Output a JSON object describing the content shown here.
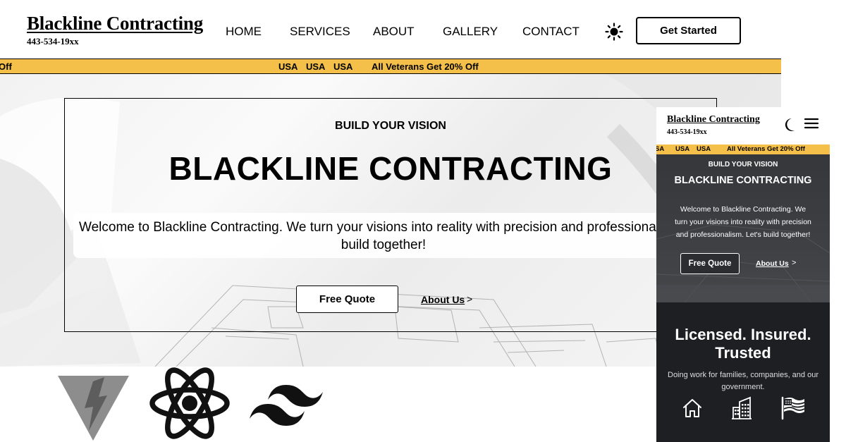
{
  "brand": {
    "name": "Blackline Contracting",
    "phone": "443-534-19xx"
  },
  "nav": [
    "HOME",
    "SERVICES",
    "ABOUT",
    "GALLERY",
    "CONTACT"
  ],
  "header": {
    "theme_icon": "sun-icon",
    "cta_label": "Get Started"
  },
  "ticker": {
    "left_fragment": "Off",
    "items": [
      "USA",
      "USA",
      "USA"
    ],
    "promo": "All Veterans Get 20% Off"
  },
  "hero": {
    "kicker": "BUILD YOUR VISION",
    "title": "BLACKLINE CONTRACTING",
    "desc_line1": "Welcome to Blackline Contracting. We turn your visions into reality with precision and professionalis",
    "desc_line2": "build together!",
    "quote_label": "Free Quote",
    "about_label": "About Us",
    "about_chevron": ">"
  },
  "logos": [
    "vite-icon",
    "react-icon",
    "tailwind-icon"
  ],
  "mobile": {
    "brand": "Blackline Contracting",
    "phone": "443-534-19xx",
    "ticker_fragment": "SA",
    "ticker_items": [
      "USA",
      "USA"
    ],
    "ticker_promo": "All Veterans Get 20% Off",
    "kicker": "BUILD YOUR VISION",
    "title": "BLACKLINE CONTRACTING",
    "desc_line1": "Welcome to Blackline Contracting. We",
    "desc_line2": "turn your visions into reality with precision",
    "desc_line3": "and professionalism. Let's build together!",
    "quote_label": "Free Quote",
    "about_label": "About Us",
    "about_chevron": ">",
    "trust_title_line1": "Licensed. Insured.",
    "trust_title_line2": "Trusted",
    "trust_desc_line1": "Doing work for families, companies, and our",
    "trust_desc_line2": "government.",
    "trust_icons": [
      "home-icon",
      "building-icon",
      "flag-icon"
    ]
  },
  "colors": {
    "ticker": "#f5c04a",
    "mobile_bg": "#2b2d31",
    "mobile_dark": "#1e1f22"
  }
}
